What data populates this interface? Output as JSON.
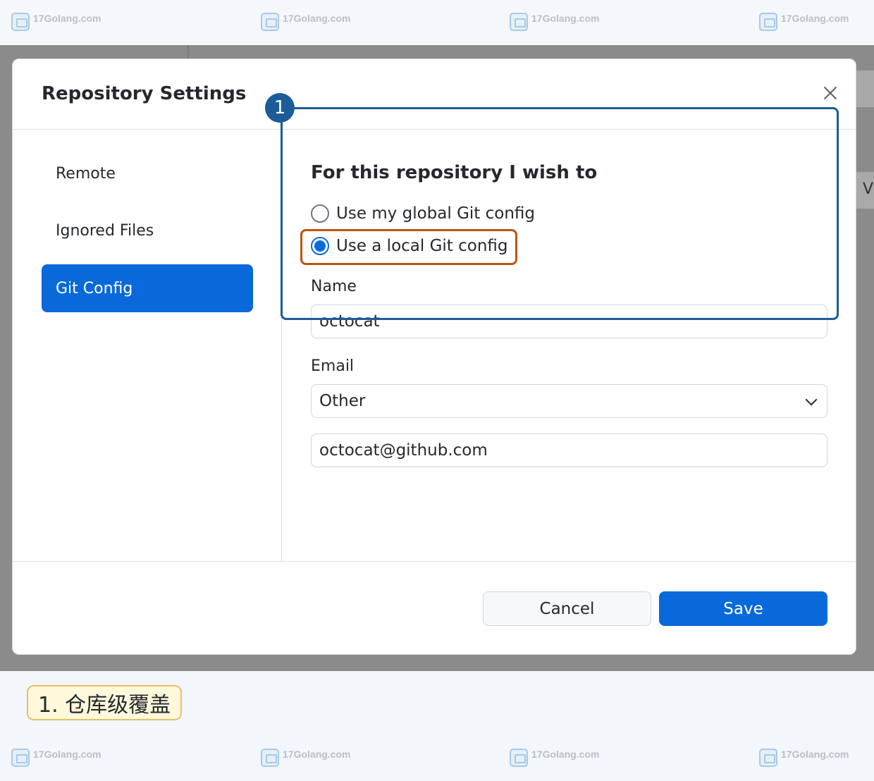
{
  "watermark": {
    "text": "17Golang.com"
  },
  "dialog": {
    "title": "Repository Settings",
    "tabs": [
      {
        "label": "Remote",
        "active": false
      },
      {
        "label": "Ignored Files",
        "active": false
      },
      {
        "label": "Git Config",
        "active": true
      }
    ],
    "git_config": {
      "section_title": "For this repository I wish to",
      "options": [
        {
          "label": "Use my global Git config",
          "checked": false
        },
        {
          "label": "Use a local Git config",
          "checked": true
        }
      ],
      "name_label": "Name",
      "name_value": "octocat",
      "email_label": "Email",
      "email_select_value": "Other",
      "email_value": "octocat@github.com"
    },
    "buttons": {
      "cancel": "Cancel",
      "save": "Save"
    }
  },
  "annotations": {
    "callout_number": "1",
    "caption": "1. 仓库级覆盖"
  },
  "background": {
    "peek_text": "V"
  },
  "colors": {
    "accent": "#0969da",
    "callout": "#1c5c98",
    "highlight": "#b8560f"
  }
}
